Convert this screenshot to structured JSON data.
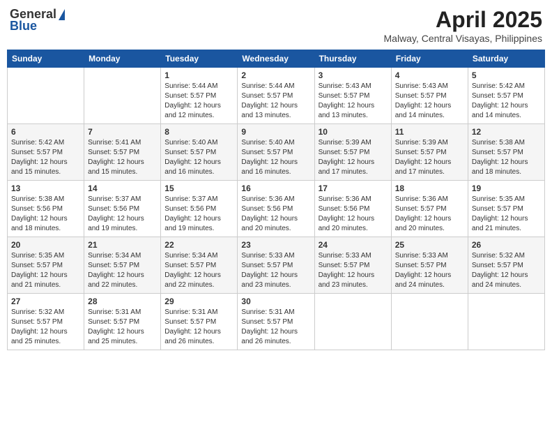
{
  "logo": {
    "general": "General",
    "blue": "Blue"
  },
  "title": {
    "month_year": "April 2025",
    "location": "Malway, Central Visayas, Philippines"
  },
  "headers": [
    "Sunday",
    "Monday",
    "Tuesday",
    "Wednesday",
    "Thursday",
    "Friday",
    "Saturday"
  ],
  "weeks": [
    [
      {
        "day": null,
        "info": null
      },
      {
        "day": null,
        "info": null
      },
      {
        "day": "1",
        "info": "Sunrise: 5:44 AM\nSunset: 5:57 PM\nDaylight: 12 hours\nand 12 minutes."
      },
      {
        "day": "2",
        "info": "Sunrise: 5:44 AM\nSunset: 5:57 PM\nDaylight: 12 hours\nand 13 minutes."
      },
      {
        "day": "3",
        "info": "Sunrise: 5:43 AM\nSunset: 5:57 PM\nDaylight: 12 hours\nand 13 minutes."
      },
      {
        "day": "4",
        "info": "Sunrise: 5:43 AM\nSunset: 5:57 PM\nDaylight: 12 hours\nand 14 minutes."
      },
      {
        "day": "5",
        "info": "Sunrise: 5:42 AM\nSunset: 5:57 PM\nDaylight: 12 hours\nand 14 minutes."
      }
    ],
    [
      {
        "day": "6",
        "info": "Sunrise: 5:42 AM\nSunset: 5:57 PM\nDaylight: 12 hours\nand 15 minutes."
      },
      {
        "day": "7",
        "info": "Sunrise: 5:41 AM\nSunset: 5:57 PM\nDaylight: 12 hours\nand 15 minutes."
      },
      {
        "day": "8",
        "info": "Sunrise: 5:40 AM\nSunset: 5:57 PM\nDaylight: 12 hours\nand 16 minutes."
      },
      {
        "day": "9",
        "info": "Sunrise: 5:40 AM\nSunset: 5:57 PM\nDaylight: 12 hours\nand 16 minutes."
      },
      {
        "day": "10",
        "info": "Sunrise: 5:39 AM\nSunset: 5:57 PM\nDaylight: 12 hours\nand 17 minutes."
      },
      {
        "day": "11",
        "info": "Sunrise: 5:39 AM\nSunset: 5:57 PM\nDaylight: 12 hours\nand 17 minutes."
      },
      {
        "day": "12",
        "info": "Sunrise: 5:38 AM\nSunset: 5:57 PM\nDaylight: 12 hours\nand 18 minutes."
      }
    ],
    [
      {
        "day": "13",
        "info": "Sunrise: 5:38 AM\nSunset: 5:56 PM\nDaylight: 12 hours\nand 18 minutes."
      },
      {
        "day": "14",
        "info": "Sunrise: 5:37 AM\nSunset: 5:56 PM\nDaylight: 12 hours\nand 19 minutes."
      },
      {
        "day": "15",
        "info": "Sunrise: 5:37 AM\nSunset: 5:56 PM\nDaylight: 12 hours\nand 19 minutes."
      },
      {
        "day": "16",
        "info": "Sunrise: 5:36 AM\nSunset: 5:56 PM\nDaylight: 12 hours\nand 20 minutes."
      },
      {
        "day": "17",
        "info": "Sunrise: 5:36 AM\nSunset: 5:56 PM\nDaylight: 12 hours\nand 20 minutes."
      },
      {
        "day": "18",
        "info": "Sunrise: 5:36 AM\nSunset: 5:57 PM\nDaylight: 12 hours\nand 20 minutes."
      },
      {
        "day": "19",
        "info": "Sunrise: 5:35 AM\nSunset: 5:57 PM\nDaylight: 12 hours\nand 21 minutes."
      }
    ],
    [
      {
        "day": "20",
        "info": "Sunrise: 5:35 AM\nSunset: 5:57 PM\nDaylight: 12 hours\nand 21 minutes."
      },
      {
        "day": "21",
        "info": "Sunrise: 5:34 AM\nSunset: 5:57 PM\nDaylight: 12 hours\nand 22 minutes."
      },
      {
        "day": "22",
        "info": "Sunrise: 5:34 AM\nSunset: 5:57 PM\nDaylight: 12 hours\nand 22 minutes."
      },
      {
        "day": "23",
        "info": "Sunrise: 5:33 AM\nSunset: 5:57 PM\nDaylight: 12 hours\nand 23 minutes."
      },
      {
        "day": "24",
        "info": "Sunrise: 5:33 AM\nSunset: 5:57 PM\nDaylight: 12 hours\nand 23 minutes."
      },
      {
        "day": "25",
        "info": "Sunrise: 5:33 AM\nSunset: 5:57 PM\nDaylight: 12 hours\nand 24 minutes."
      },
      {
        "day": "26",
        "info": "Sunrise: 5:32 AM\nSunset: 5:57 PM\nDaylight: 12 hours\nand 24 minutes."
      }
    ],
    [
      {
        "day": "27",
        "info": "Sunrise: 5:32 AM\nSunset: 5:57 PM\nDaylight: 12 hours\nand 25 minutes."
      },
      {
        "day": "28",
        "info": "Sunrise: 5:31 AM\nSunset: 5:57 PM\nDaylight: 12 hours\nand 25 minutes."
      },
      {
        "day": "29",
        "info": "Sunrise: 5:31 AM\nSunset: 5:57 PM\nDaylight: 12 hours\nand 26 minutes."
      },
      {
        "day": "30",
        "info": "Sunrise: 5:31 AM\nSunset: 5:57 PM\nDaylight: 12 hours\nand 26 minutes."
      },
      {
        "day": null,
        "info": null
      },
      {
        "day": null,
        "info": null
      },
      {
        "day": null,
        "info": null
      }
    ]
  ]
}
